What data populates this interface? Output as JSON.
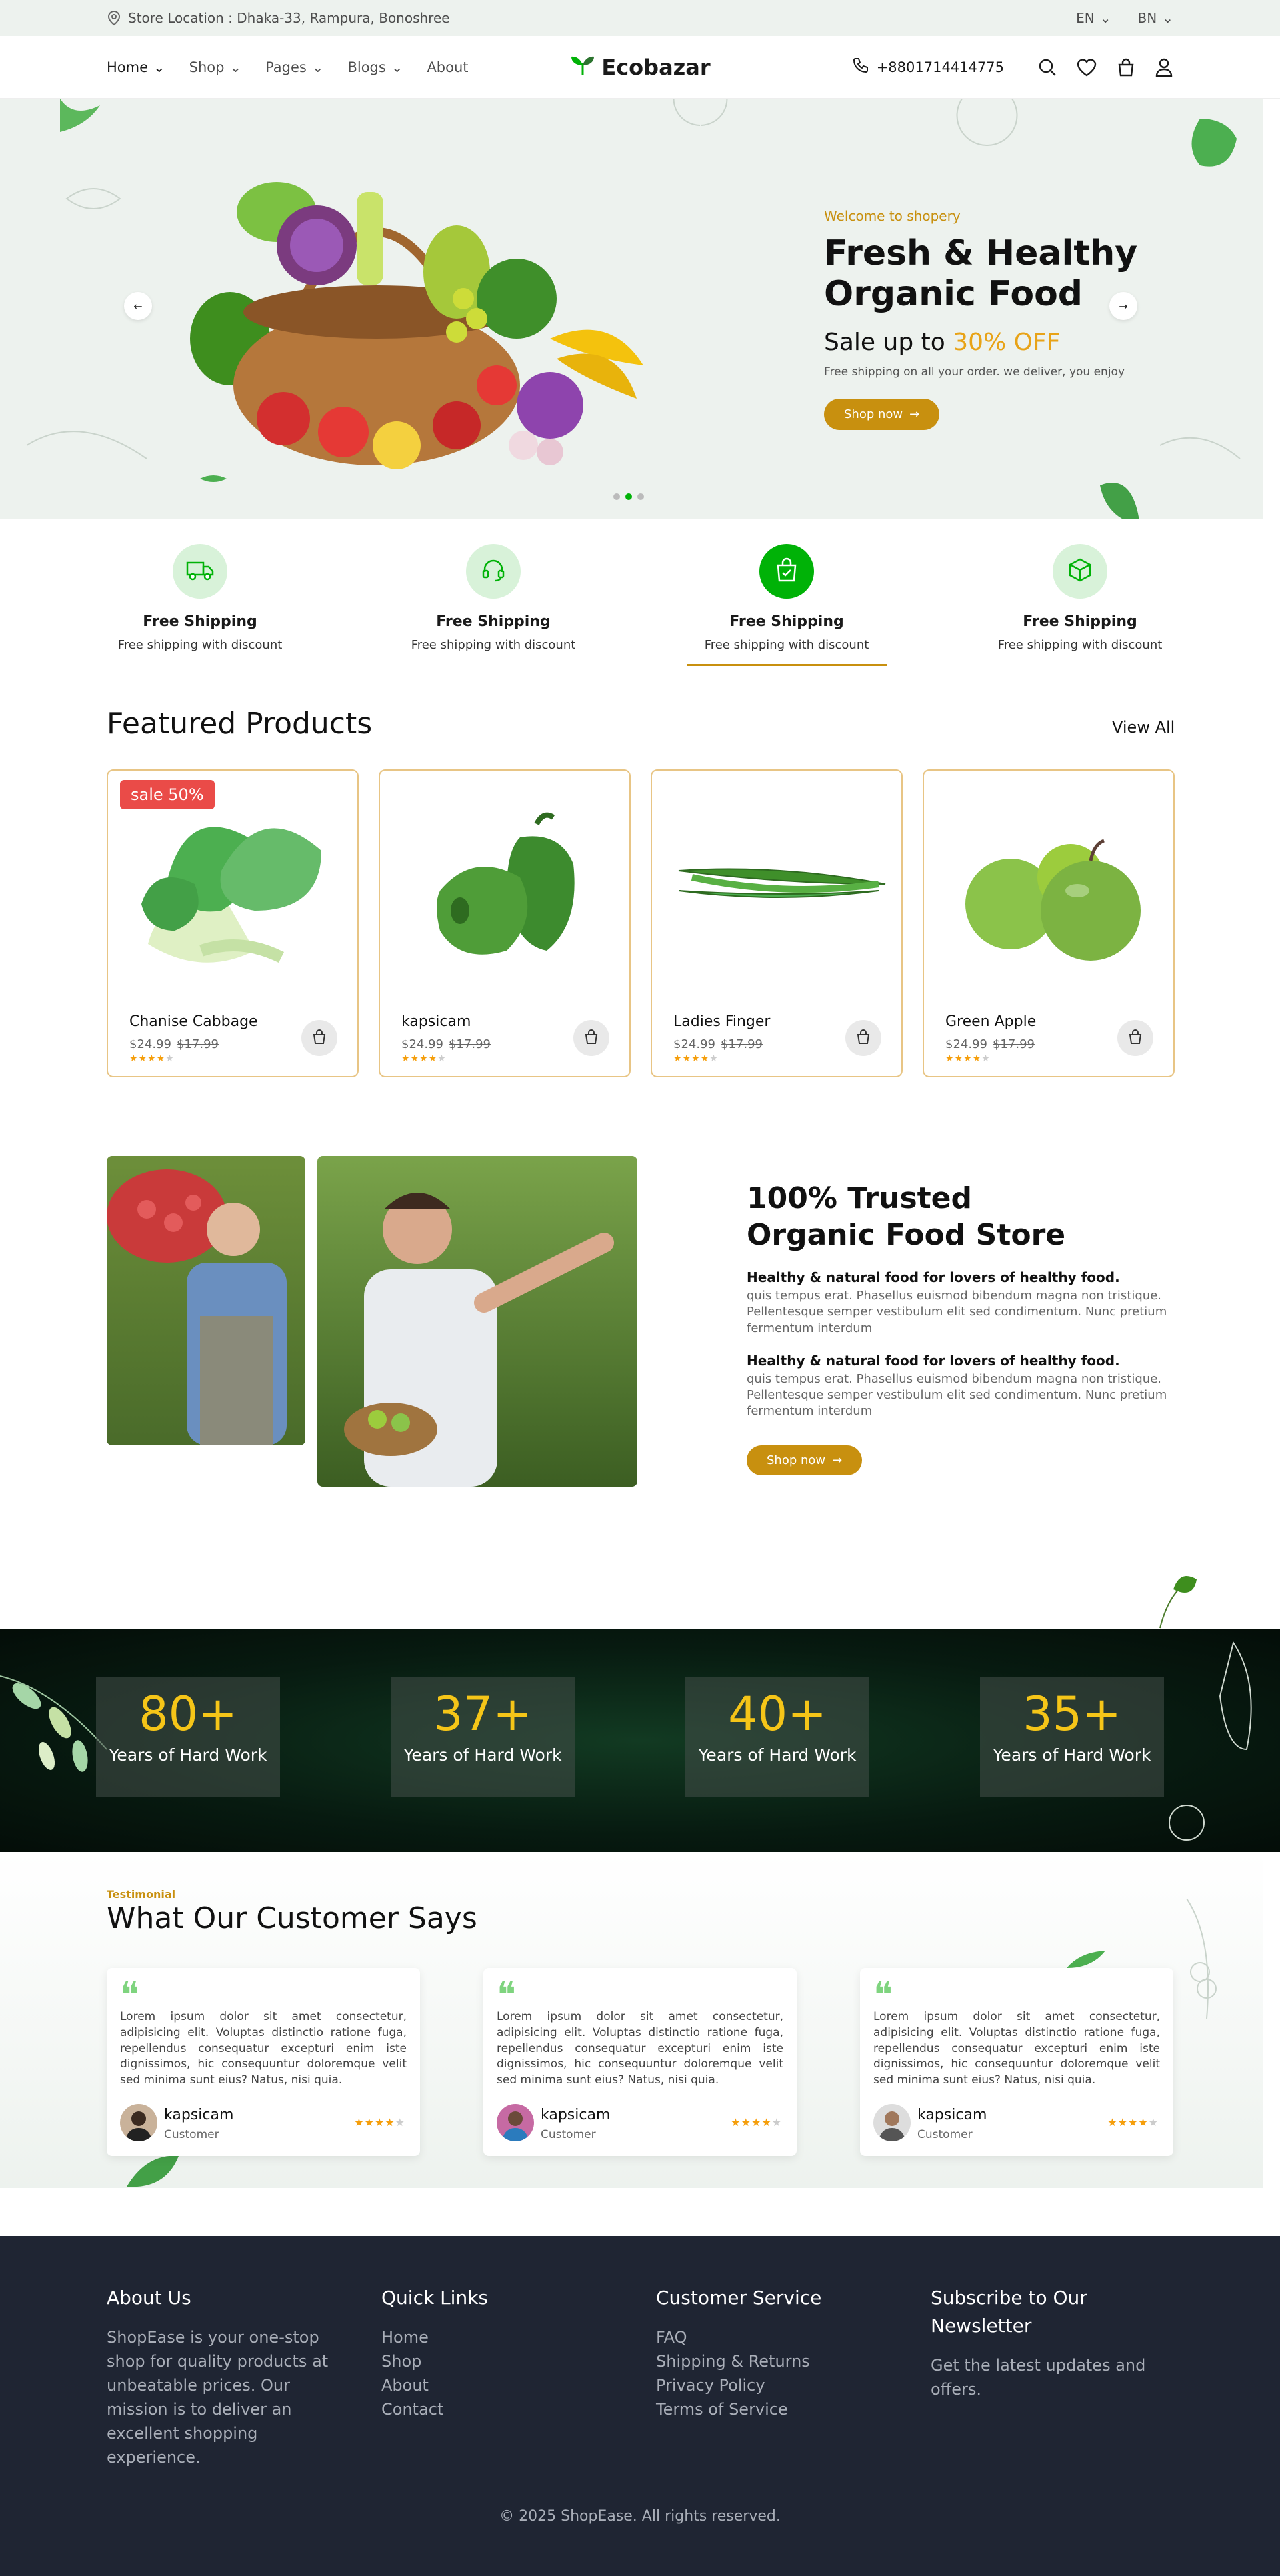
{
  "topbar": {
    "location": "Store Location : Dhaka-33, Rampura, Bonoshree",
    "lang1": "EN",
    "lang2": "BN"
  },
  "nav": {
    "links": [
      "Home",
      "Shop",
      "Pages",
      "Blogs",
      "About"
    ],
    "brand": "Ecobazar",
    "phone": "+8801714414775"
  },
  "hero": {
    "welcome": "Welcome to shopery",
    "title_line1": "Fresh & Healthy",
    "title_line2": "Organic Food",
    "sale_prefix": "Sale up to",
    "sale_pct": "30% OFF",
    "subtitle": "Free shipping on all your order. we deliver, you enjoy",
    "button": "Shop now"
  },
  "features": [
    {
      "title": "Free Shipping",
      "sub": "Free shipping with discount",
      "icon": "truck-icon"
    },
    {
      "title": "Free Shipping",
      "sub": "Free shipping with discount",
      "icon": "headset-icon"
    },
    {
      "title": "Free Shipping",
      "sub": "Free shipping with discount",
      "icon": "shopping-bag-icon"
    },
    {
      "title": "Free Shipping",
      "sub": "Free shipping with discount",
      "icon": "package-icon"
    }
  ],
  "featured": {
    "title": "Featured Products",
    "view_all": "View All",
    "sale_badge": "sale 50%"
  },
  "products": [
    {
      "name": "Chanise Cabbage",
      "price": "$24.99",
      "old": "$17.99",
      "rating": 4
    },
    {
      "name": "kapsicam",
      "price": "$24.99",
      "old": "$17.99",
      "rating": 4
    },
    {
      "name": "Ladies Finger",
      "price": "$24.99",
      "old": "$17.99",
      "rating": 4
    },
    {
      "name": "Green Apple",
      "price": "$24.99",
      "old": "$17.99",
      "rating": 4
    }
  ],
  "trusted": {
    "title_line1": "100% Trusted",
    "title_line2": "Organic Food Store",
    "s1_title": "Healthy & natural food for lovers of healthy food.",
    "s1_text": "quis tempus erat. Phasellus euismod bibendum magna non tristique. Pellentesque semper vestibulum elit sed condimentum. Nunc pretium fermentum interdum",
    "s2_title": "Healthy & natural food for lovers of healthy food.",
    "s2_text": "quis tempus erat. Phasellus euismod bibendum magna non tristique. Pellentesque semper vestibulum elit sed condimentum. Nunc pretium fermentum interdum",
    "button": "Shop now"
  },
  "stats": [
    {
      "num": "80+",
      "label": "Years of Hard Work"
    },
    {
      "num": "37+",
      "label": "Years of Hard Work"
    },
    {
      "num": "40+",
      "label": "Years of Hard Work"
    },
    {
      "num": "35+",
      "label": "Years of Hard Work"
    }
  ],
  "testimonial": {
    "tag": "Testimonial",
    "title": "What Our Customer Says",
    "items": [
      {
        "text": "Lorem ipsum dolor sit amet consectetur, adipisicing elit. Voluptas distinctio ratione fuga, repellendus consequatur excepturi enim iste dignissimos, hic consequuntur doloremque velit sed minima sunt eius? Natus, nisi quia.",
        "name": "kapsicam",
        "role": "Customer",
        "rating": 4
      },
      {
        "text": "Lorem ipsum dolor sit amet consectetur, adipisicing elit. Voluptas distinctio ratione fuga, repellendus consequatur excepturi enim iste dignissimos, hic consequuntur doloremque velit sed minima sunt eius? Natus, nisi quia.",
        "name": "kapsicam",
        "role": "Customer",
        "rating": 4
      },
      {
        "text": "Lorem ipsum dolor sit amet consectetur, adipisicing elit. Voluptas distinctio ratione fuga, repellendus consequatur excepturi enim iste dignissimos, hic consequuntur doloremque velit sed minima sunt eius? Natus, nisi quia.",
        "name": "kapsicam",
        "role": "Customer",
        "rating": 4
      }
    ]
  },
  "footer": {
    "about_title": "About Us",
    "about_text": "ShopEase is your one-stop shop for quality products at unbeatable prices. Our mission is to deliver an excellent shopping experience.",
    "quick_title": "Quick Links",
    "quick_links": [
      "Home",
      "Shop",
      "About",
      "Contact"
    ],
    "service_title": "Customer Service",
    "service_links": [
      "FAQ",
      "Shipping & Returns",
      "Privacy Policy",
      "Terms of Service"
    ],
    "news_title": "Subscribe to Our Newsletter",
    "news_text": "Get the latest updates and offers.",
    "copyright": "© 2025 ShopEase. All rights reserved."
  },
  "colors": {
    "accent": "#c8900f",
    "green": "#00b207",
    "footer_bg": "#1f2533",
    "sale_red": "#ea4b48"
  }
}
